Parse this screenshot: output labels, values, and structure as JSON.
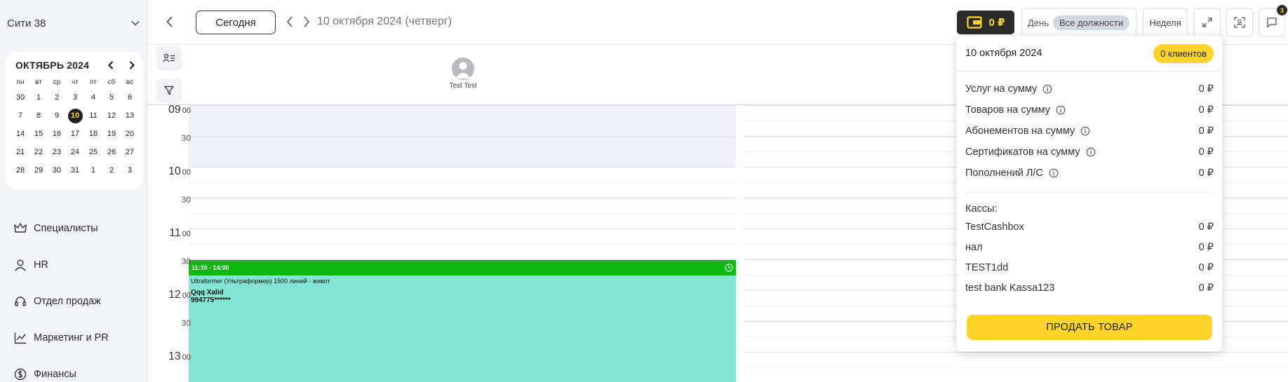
{
  "sidebar": {
    "branch": "Сити 38",
    "mini_calendar": {
      "title": "ОКТЯБРЬ 2024",
      "weekdays": [
        "пн",
        "вт",
        "ср",
        "чт",
        "пт",
        "сб",
        "вс"
      ],
      "days": [
        "30",
        "1",
        "2",
        "3",
        "4",
        "5",
        "6",
        "7",
        "8",
        "9",
        "10",
        "11",
        "12",
        "13",
        "14",
        "15",
        "16",
        "17",
        "18",
        "19",
        "20",
        "21",
        "22",
        "23",
        "24",
        "25",
        "26",
        "27",
        "28",
        "29",
        "30",
        "31",
        "1",
        "2",
        "3"
      ],
      "selected": "10"
    },
    "nav": [
      {
        "label": "Специалисты",
        "icon": "crown-icon"
      },
      {
        "label": "HR",
        "icon": "user-icon"
      },
      {
        "label": "Отдел продаж",
        "icon": "headset-icon"
      },
      {
        "label": "Маркетинг и PR",
        "icon": "chart-line-icon"
      },
      {
        "label": "Финансы",
        "icon": "dollar-circle-icon"
      }
    ]
  },
  "toolbar": {
    "today_label": "Сегодня",
    "date_label": "10 октября 2024 (четверг)",
    "wallet_amount": "0 ₽",
    "view_day": "День",
    "positions_filter": "Все должности",
    "week_label": "Неделя",
    "notifications_count": "3"
  },
  "schedule": {
    "staff": [
      {
        "name": "Test Test"
      }
    ],
    "hours": [
      {
        "hour": "09",
        "min": "00",
        "half": "30"
      },
      {
        "hour": "10",
        "min": "00",
        "half": "30"
      },
      {
        "hour": "11",
        "min": "00",
        "half": "30"
      },
      {
        "hour": "12",
        "min": "00",
        "half": "30"
      },
      {
        "hour": "13",
        "min": "00",
        "half": ""
      }
    ],
    "appointment": {
      "time": "11:30 - 14:00",
      "service": "Ultraformer (Ультраформер) 1500 линий - живот",
      "client": "Qqq Xalid",
      "phone": "994775******",
      "header_color": "#0eb80e",
      "body_color": "#85e5d4"
    }
  },
  "popover": {
    "date": "10 октября 2024",
    "clients_badge": "0 клиентов",
    "sums": [
      {
        "label": "Услуг на сумму",
        "value": "0 ₽"
      },
      {
        "label": "Товаров на сумму",
        "value": "0 ₽"
      },
      {
        "label": "Абонементов на сумму",
        "value": "0 ₽"
      },
      {
        "label": "Сертификатов на сумму",
        "value": "0 ₽"
      },
      {
        "label": "Пополнений Л/С",
        "value": "0 ₽"
      }
    ],
    "cashboxes_title": "Кассы:",
    "cashboxes": [
      {
        "label": "TestCashbox",
        "value": "0 ₽"
      },
      {
        "label": "нал",
        "value": "0 ₽"
      },
      {
        "label": "TEST1dd",
        "value": "0 ₽"
      },
      {
        "label": "test bank Kassa123",
        "value": "0 ₽"
      }
    ],
    "sell_button": "ПРОДАТЬ ТОВАР"
  },
  "colors": {
    "accent": "#ffd42a",
    "dark": "#2b2b2b",
    "sidebar_bg": "#f4f5f9"
  }
}
